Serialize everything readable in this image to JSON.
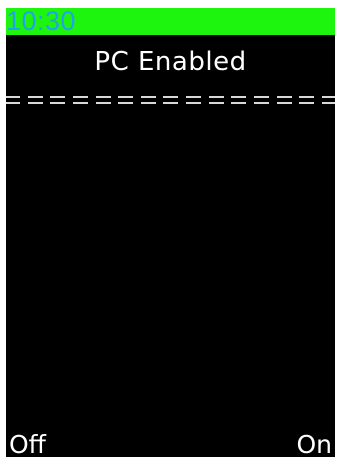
{
  "status_bar": {
    "time": "10:30",
    "color": "#1ef50f",
    "time_color": "#22a3e6"
  },
  "screen": {
    "title": "PC Enabled"
  },
  "softkeys": {
    "left_label": "Off",
    "right_label": "On"
  }
}
